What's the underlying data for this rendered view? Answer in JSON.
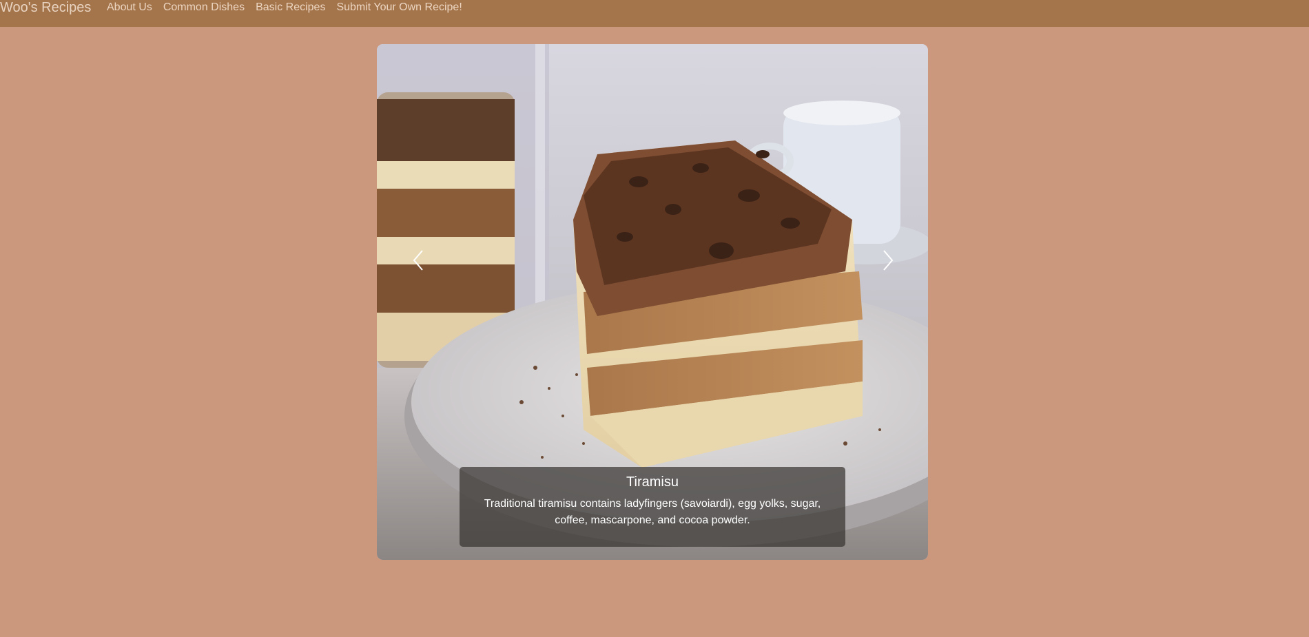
{
  "navbar": {
    "brand": "Woo's Recipes",
    "links": [
      "About Us",
      "Common Dishes",
      "Basic Recipes",
      "Submit Your Own Recipe!"
    ]
  },
  "carousel": {
    "slide": {
      "title": "Tiramisu",
      "description": "Traditional tiramisu contains ladyfingers (savoiardi), egg yolks, sugar, coffee, mascarpone, and cocoa powder."
    },
    "prev_icon": "chevron-left-icon",
    "next_icon": "chevron-right-icon"
  },
  "colors": {
    "page_background": "#cc987d",
    "navbar_background": "#a4744b",
    "nav_text": "#ecd6c2"
  }
}
